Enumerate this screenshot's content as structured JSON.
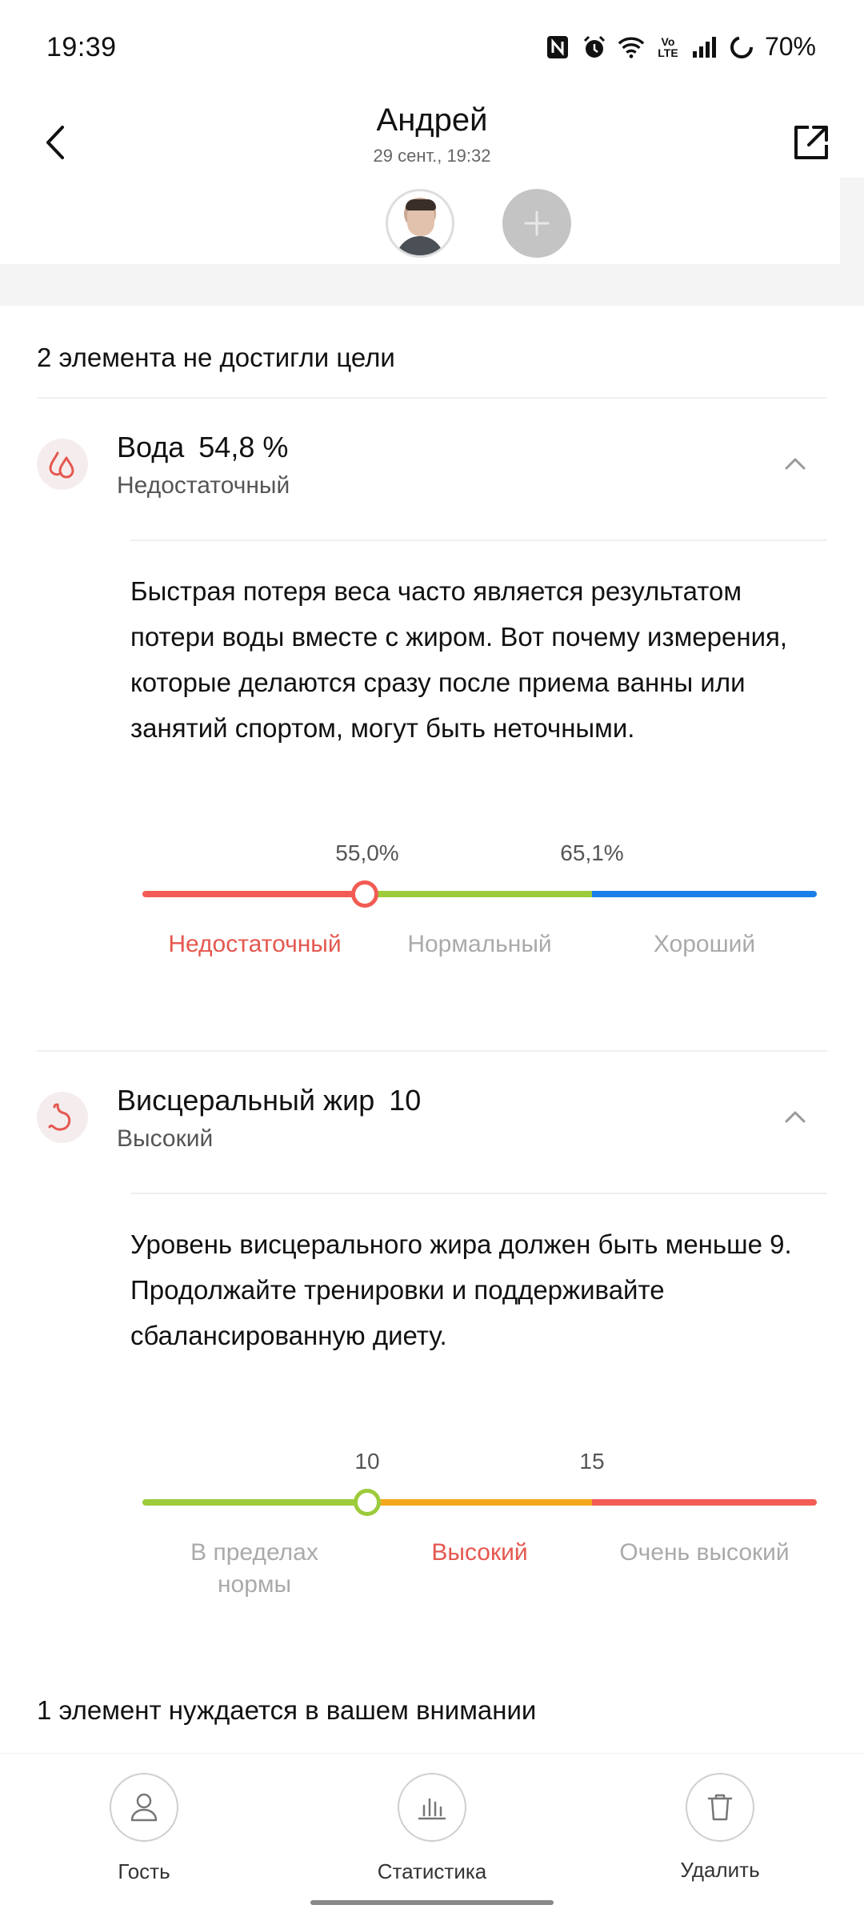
{
  "status_bar": {
    "time": "19:39",
    "battery": "70%",
    "icons": [
      "nfc-icon",
      "alarm-icon",
      "wifi-icon",
      "volte-icon",
      "signal-icon",
      "battery-icon"
    ]
  },
  "header": {
    "title": "Андрей",
    "subtitle": "29 сент., 19:32"
  },
  "section_not_reached": {
    "heading": "2 элемента не достигли цели"
  },
  "water": {
    "label": "Вода",
    "value": "54,8 %",
    "status": "Недостаточный",
    "description": "Быстрая потеря веса часто является результатом потери воды вместе с жиром. Вот почему измерения, которые делаются сразу после приема ванны или занятий спортом, могут быть неточными.",
    "thresholds": [
      "55,0%",
      "65,1%"
    ],
    "ranges": [
      "Недостаточный",
      "Нормальный",
      "Хороший"
    ],
    "marker_position": 0.33,
    "colors": [
      "#f25c54",
      "#9ccb3b",
      "#1a7fe8"
    ],
    "status_color": "#e5574f"
  },
  "visceral": {
    "label": "Висцеральный жир",
    "value": "10",
    "status": "Высокий",
    "description": "Уровень висцерального жира должен быть меньше 9. Продолжайте тренировки и поддерживайте сбалансированную диету.",
    "thresholds": [
      "10",
      "15"
    ],
    "ranges": [
      "В пределах нормы",
      "Высокий",
      "Очень высокий"
    ],
    "marker_position": 0.333,
    "colors": [
      "#9ccb3b",
      "#f3a81c",
      "#f25c54"
    ],
    "status_color": "#e5574f"
  },
  "section_attention": {
    "heading": "1 элемент нуждается в вашем внимании"
  },
  "bottom_nav": {
    "guest": "Гость",
    "stats": "Статистика",
    "delete": "Удалить"
  }
}
